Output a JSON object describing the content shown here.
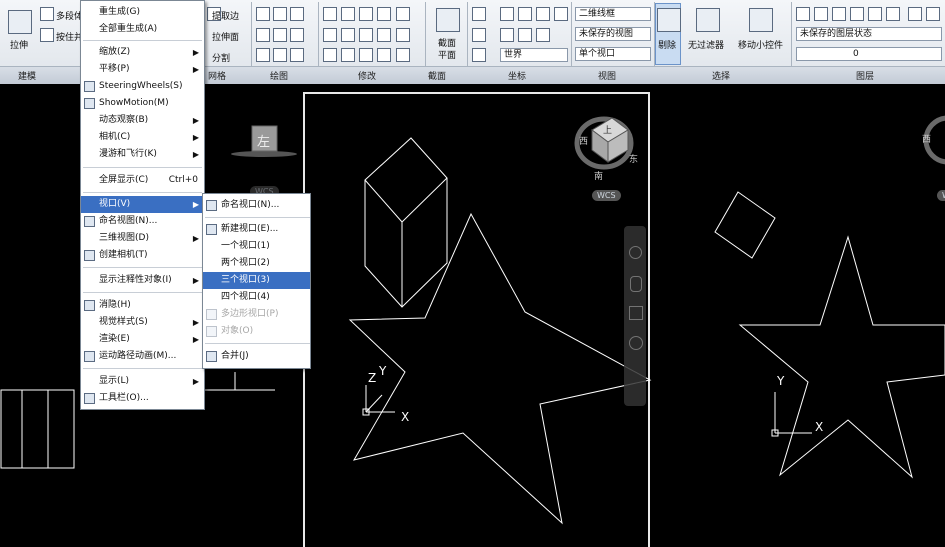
{
  "ribbon": {
    "buttons": {
      "stretch": "拉伸",
      "multi_segment": "多段体",
      "press_pull": "按住并",
      "extract_edge": "提取边",
      "stretch_face": "拉伸面",
      "split": "分割",
      "section_plane_1": "截面",
      "section_plane_2": "平面",
      "visual_style": "二维线框",
      "unsaved_view": "未保存的视图",
      "single_viewport": "单个视口",
      "world": "世界",
      "cull": "剔除",
      "no_filter": "无过滤器",
      "move_gizmo": "移动小控件",
      "layer_state": "未保存的图层状态",
      "layer_current": "0"
    },
    "panels": [
      "建模",
      "网格",
      "绘图",
      "修改",
      "截面",
      "坐标",
      "视图",
      "选择",
      "图层"
    ]
  },
  "main_menu": {
    "items": [
      {
        "label": "重生成(G)",
        "shortcut": "",
        "arrow": false
      },
      {
        "label": "全部重生成(A)",
        "shortcut": "",
        "arrow": false
      },
      {
        "label": "缩放(Z)",
        "shortcut": "",
        "arrow": true
      },
      {
        "label": "平移(P)",
        "shortcut": "",
        "arrow": true
      },
      {
        "label": "SteeringWheels(S)",
        "shortcut": "",
        "arrow": false
      },
      {
        "label": "ShowMotion(M)",
        "shortcut": "",
        "arrow": false
      },
      {
        "label": "动态观察(B)",
        "shortcut": "",
        "arrow": true
      },
      {
        "label": "相机(C)",
        "shortcut": "",
        "arrow": true
      },
      {
        "label": "漫游和飞行(K)",
        "shortcut": "",
        "arrow": true
      },
      {
        "label": "全屏显示(C)",
        "shortcut": "Ctrl+0",
        "arrow": false
      },
      {
        "label": "视口(V)",
        "shortcut": "",
        "arrow": true
      },
      {
        "label": "命名视图(N)...",
        "shortcut": "",
        "arrow": false
      },
      {
        "label": "三维视图(D)",
        "shortcut": "",
        "arrow": true
      },
      {
        "label": "创建相机(T)",
        "shortcut": "",
        "arrow": false
      },
      {
        "label": "显示注释性对象(I)",
        "shortcut": "",
        "arrow": true
      },
      {
        "label": "消隐(H)",
        "shortcut": "",
        "arrow": false
      },
      {
        "label": "视觉样式(S)",
        "shortcut": "",
        "arrow": true
      },
      {
        "label": "渲染(E)",
        "shortcut": "",
        "arrow": true
      },
      {
        "label": "运动路径动画(M)...",
        "shortcut": "",
        "arrow": false
      },
      {
        "label": "显示(L)",
        "shortcut": "",
        "arrow": true
      },
      {
        "label": "工具栏(O)...",
        "shortcut": "",
        "arrow": false
      }
    ]
  },
  "viewport_submenu": {
    "items": [
      {
        "label": "命名视口(N)...",
        "state": "normal"
      },
      {
        "label": "新建视口(E)...",
        "state": "normal"
      },
      {
        "label": "一个视口(1)",
        "state": "normal"
      },
      {
        "label": "两个视口(2)",
        "state": "normal"
      },
      {
        "label": "三个视口(3)",
        "state": "selected"
      },
      {
        "label": "四个视口(4)",
        "state": "normal"
      },
      {
        "label": "多边形视口(P)",
        "state": "disabled"
      },
      {
        "label": "对象(O)",
        "state": "disabled"
      },
      {
        "label": "合并(J)",
        "state": "normal"
      }
    ]
  },
  "viewcube": {
    "left_face": "左",
    "top_face": "上",
    "south": "南",
    "east": "东",
    "west": "西",
    "wcs": "WCS"
  },
  "axes": {
    "x": "X",
    "y": "Y",
    "z": "Z"
  },
  "colors": {
    "menu_highlight": "#3a6fc2",
    "canvas": "#000000",
    "lines": "#ffffff"
  }
}
